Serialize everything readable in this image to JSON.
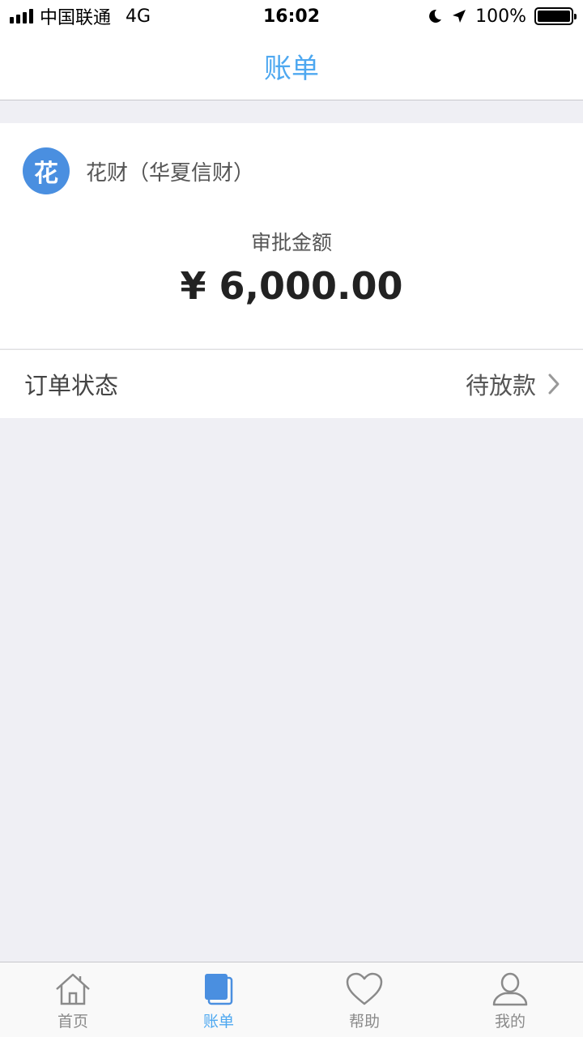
{
  "status_bar": {
    "carrier": "中国联通",
    "network": "4G",
    "time": "16:02",
    "battery": "100%",
    "battery_level": 1.0,
    "icons": [
      "signal-icon",
      "moon-icon",
      "location-arrow-icon",
      "battery-icon"
    ]
  },
  "nav": {
    "title": "账单"
  },
  "product": {
    "logo_char": "花",
    "name": "花财（华夏信财）"
  },
  "amount": {
    "label": "审批金额",
    "value": "¥ 6,000.00"
  },
  "order_status": {
    "label": "订单状态",
    "value": "待放款"
  },
  "tabs": [
    {
      "label": "首页",
      "icon": "home-icon",
      "active": false
    },
    {
      "label": "账单",
      "icon": "bill-icon",
      "active": true
    },
    {
      "label": "帮助",
      "icon": "heart-icon",
      "active": false
    },
    {
      "label": "我的",
      "icon": "user-icon",
      "active": false
    }
  ],
  "colors": {
    "accent": "#4ea8f0",
    "logo": "#4a8fe0",
    "background": "#efeff4"
  }
}
